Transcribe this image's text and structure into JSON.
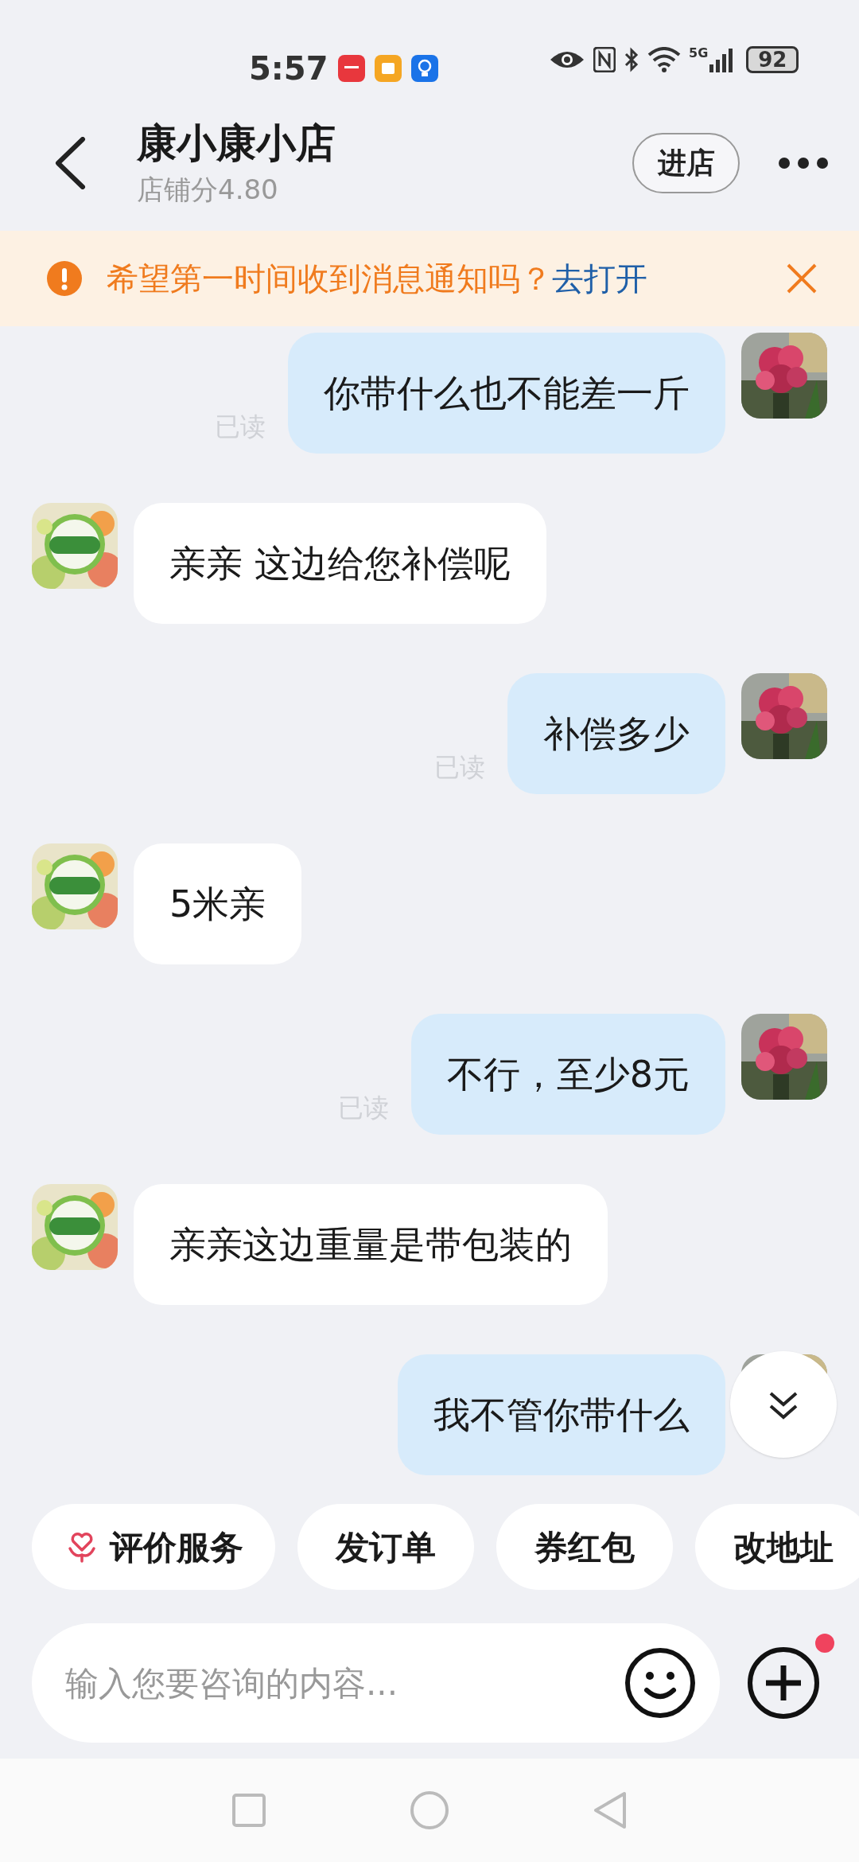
{
  "status_bar": {
    "time": "5:57",
    "network": "5G",
    "battery": "92"
  },
  "header": {
    "title": "康小康小店",
    "subtitle": "店铺分4.80",
    "enter_button": "进店"
  },
  "notice": {
    "text": "希望第一时间收到消息通知吗？",
    "link": "去打开"
  },
  "messages": [
    {
      "kind": "me",
      "text": "你带什么也不能差一斤",
      "read_label": "已读"
    },
    {
      "kind": "shop",
      "text": "亲亲 这边给您补偿呢"
    },
    {
      "kind": "me",
      "text": "补偿多少",
      "read_label": "已读"
    },
    {
      "kind": "shop",
      "text": "5米亲"
    },
    {
      "kind": "me",
      "text": "不行，至少8元",
      "read_label": "已读"
    },
    {
      "kind": "shop",
      "text": "亲亲这边重量是带包装的"
    },
    {
      "kind": "me",
      "text": "我不管你带什么"
    }
  ],
  "quick_actions": [
    {
      "label": "评价服务",
      "kind": "icon"
    },
    {
      "label": "发订单",
      "kind": "plain"
    },
    {
      "label": "券红包",
      "kind": "plain"
    },
    {
      "label": "改地址",
      "kind": "plain"
    }
  ],
  "input": {
    "placeholder": "输入您要咨询的内容...",
    "plus_badge": true
  }
}
